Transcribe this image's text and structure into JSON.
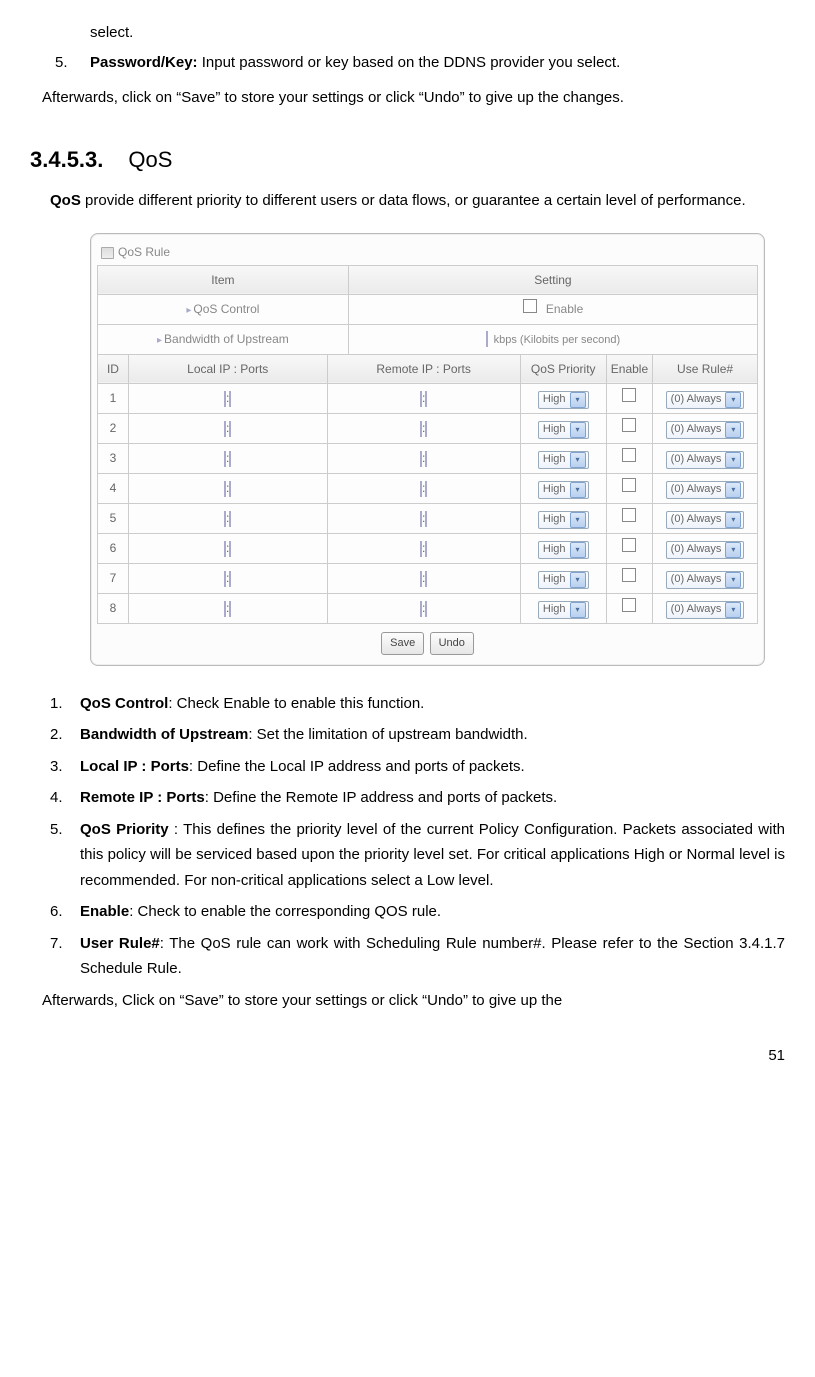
{
  "top": {
    "select_trail": "select.",
    "item5_num": "5.",
    "item5_label": "Password/Key:",
    "item5_text": " Input password or key based on the DDNS provider you select.",
    "afterwards": "Afterwards, click on “Save” to store your settings or click “Undo” to give up the changes."
  },
  "section": {
    "number": "3.4.5.3.",
    "title": "QoS",
    "desc_bold": "QoS",
    "desc_rest": " provide different priority to different users or data flows, or guarantee a certain level of performance."
  },
  "widget": {
    "title": "QoS Rule",
    "th_item": "Item",
    "th_setting": "Setting",
    "row_qos_control": "QoS Control",
    "enable_label": "Enable",
    "row_bandwidth": "Bandwidth of Upstream",
    "kbps": "kbps (Kilobits per second)",
    "cols": {
      "id": "ID",
      "local": "Local IP : Ports",
      "remote": "Remote IP : Ports",
      "priority": "QoS Priority",
      "enable": "Enable",
      "rule": "Use Rule#"
    },
    "priority_value": "High",
    "rule_value": "(0) Always",
    "row_ids": [
      "1",
      "2",
      "3",
      "4",
      "5",
      "6",
      "7",
      "8"
    ],
    "btn_save": "Save",
    "btn_undo": "Undo"
  },
  "bottom": {
    "items": [
      {
        "num": "1.",
        "bold": "QoS Control",
        "rest": ": Check Enable to enable this function."
      },
      {
        "num": "2.",
        "bold": "Bandwidth of Upstream",
        "rest": ": Set the limitation of upstream bandwidth."
      },
      {
        "num": "3.",
        "bold": "Local IP : Ports",
        "rest": ": Define the Local IP address and ports of packets."
      },
      {
        "num": "4.",
        "bold": "Remote IP : Ports",
        "rest": ": Define the Remote IP address and ports of packets."
      },
      {
        "num": "5.",
        "bold": "QoS Priority",
        "rest": " : This defines the priority level of the current Policy Configuration. Packets associated with this policy will be serviced based upon the priority level set. For critical applications High or Normal level is recommended. For non-critical applications select a Low level."
      },
      {
        "num": "6.",
        "bold": "Enable",
        "rest": ": Check to enable the corresponding QOS rule."
      },
      {
        "num": "7.",
        "bold": "User Rule#",
        "rest": ": The QoS rule can work with Scheduling Rule number#. Please refer to the Section 3.4.1.7 Schedule Rule."
      }
    ],
    "afterwards": "Afterwards, Click on “Save” to store your settings or click “Undo” to give up the"
  },
  "page": "51"
}
